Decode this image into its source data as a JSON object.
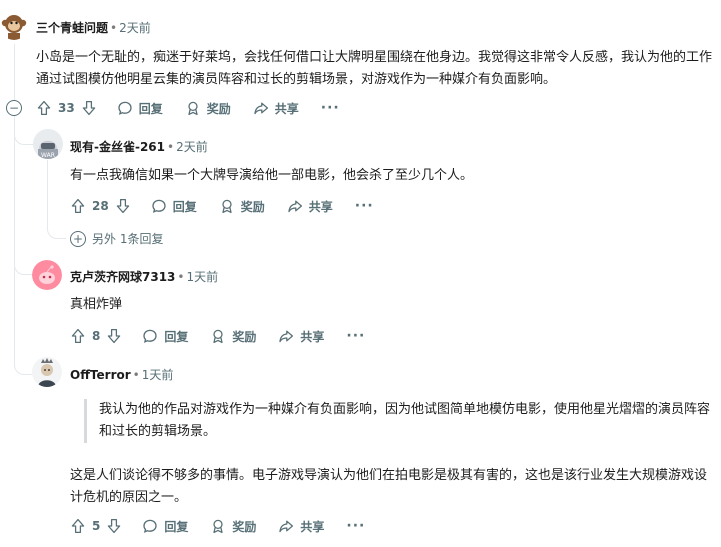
{
  "c1": {
    "author": "三个青蛙问题",
    "time": "2天前",
    "text": "小岛是一个无耻的，痴迷于好莱坞，会找任何借口让大牌明星围绕在他身边。我觉得这非常令人反感，我认为他的工作通过试图模仿他明星云集的演员阵容和过长的剪辑场景，对游戏作为一种媒介有负面影响。",
    "votes": "33",
    "reply": "回复",
    "award": "奖励",
    "share": "共享",
    "more": "···"
  },
  "c2": {
    "author": "现有-金丝雀-261",
    "time": "2天前",
    "text": "有一点我确信如果一个大牌导演给他一部电影，他会杀了至少几个人。",
    "votes": "28",
    "reply": "回复",
    "award": "奖励",
    "share": "共享",
    "more": "···",
    "more_replies": "另外 1条回复"
  },
  "c3": {
    "author": "克卢茨齐网球7313",
    "time": "1天前",
    "text": "真相炸弹",
    "votes": "8",
    "reply": "回复",
    "award": "奖励",
    "share": "共享",
    "more": "···"
  },
  "c4": {
    "author": "OffTerror",
    "time": "1天前",
    "quote": "我认为他的作品对游戏作为一种媒介有负面影响，因为他试图简单地模仿电影，使用他星光熠熠的演员阵容和过长的剪辑场景。",
    "text": "这是人们谈论得不够多的事情。电子游戏导演认为他们在拍电影是极其有害的，这也是该行业发生大规模游戏设计危机的原因之一。",
    "votes": "5",
    "reply": "回复",
    "award": "奖励",
    "share": "共享",
    "more": "···"
  },
  "colors": {
    "meta": "#576f76",
    "thread_line": "#e5e9ec",
    "quote_bar": "#d7dadc"
  }
}
